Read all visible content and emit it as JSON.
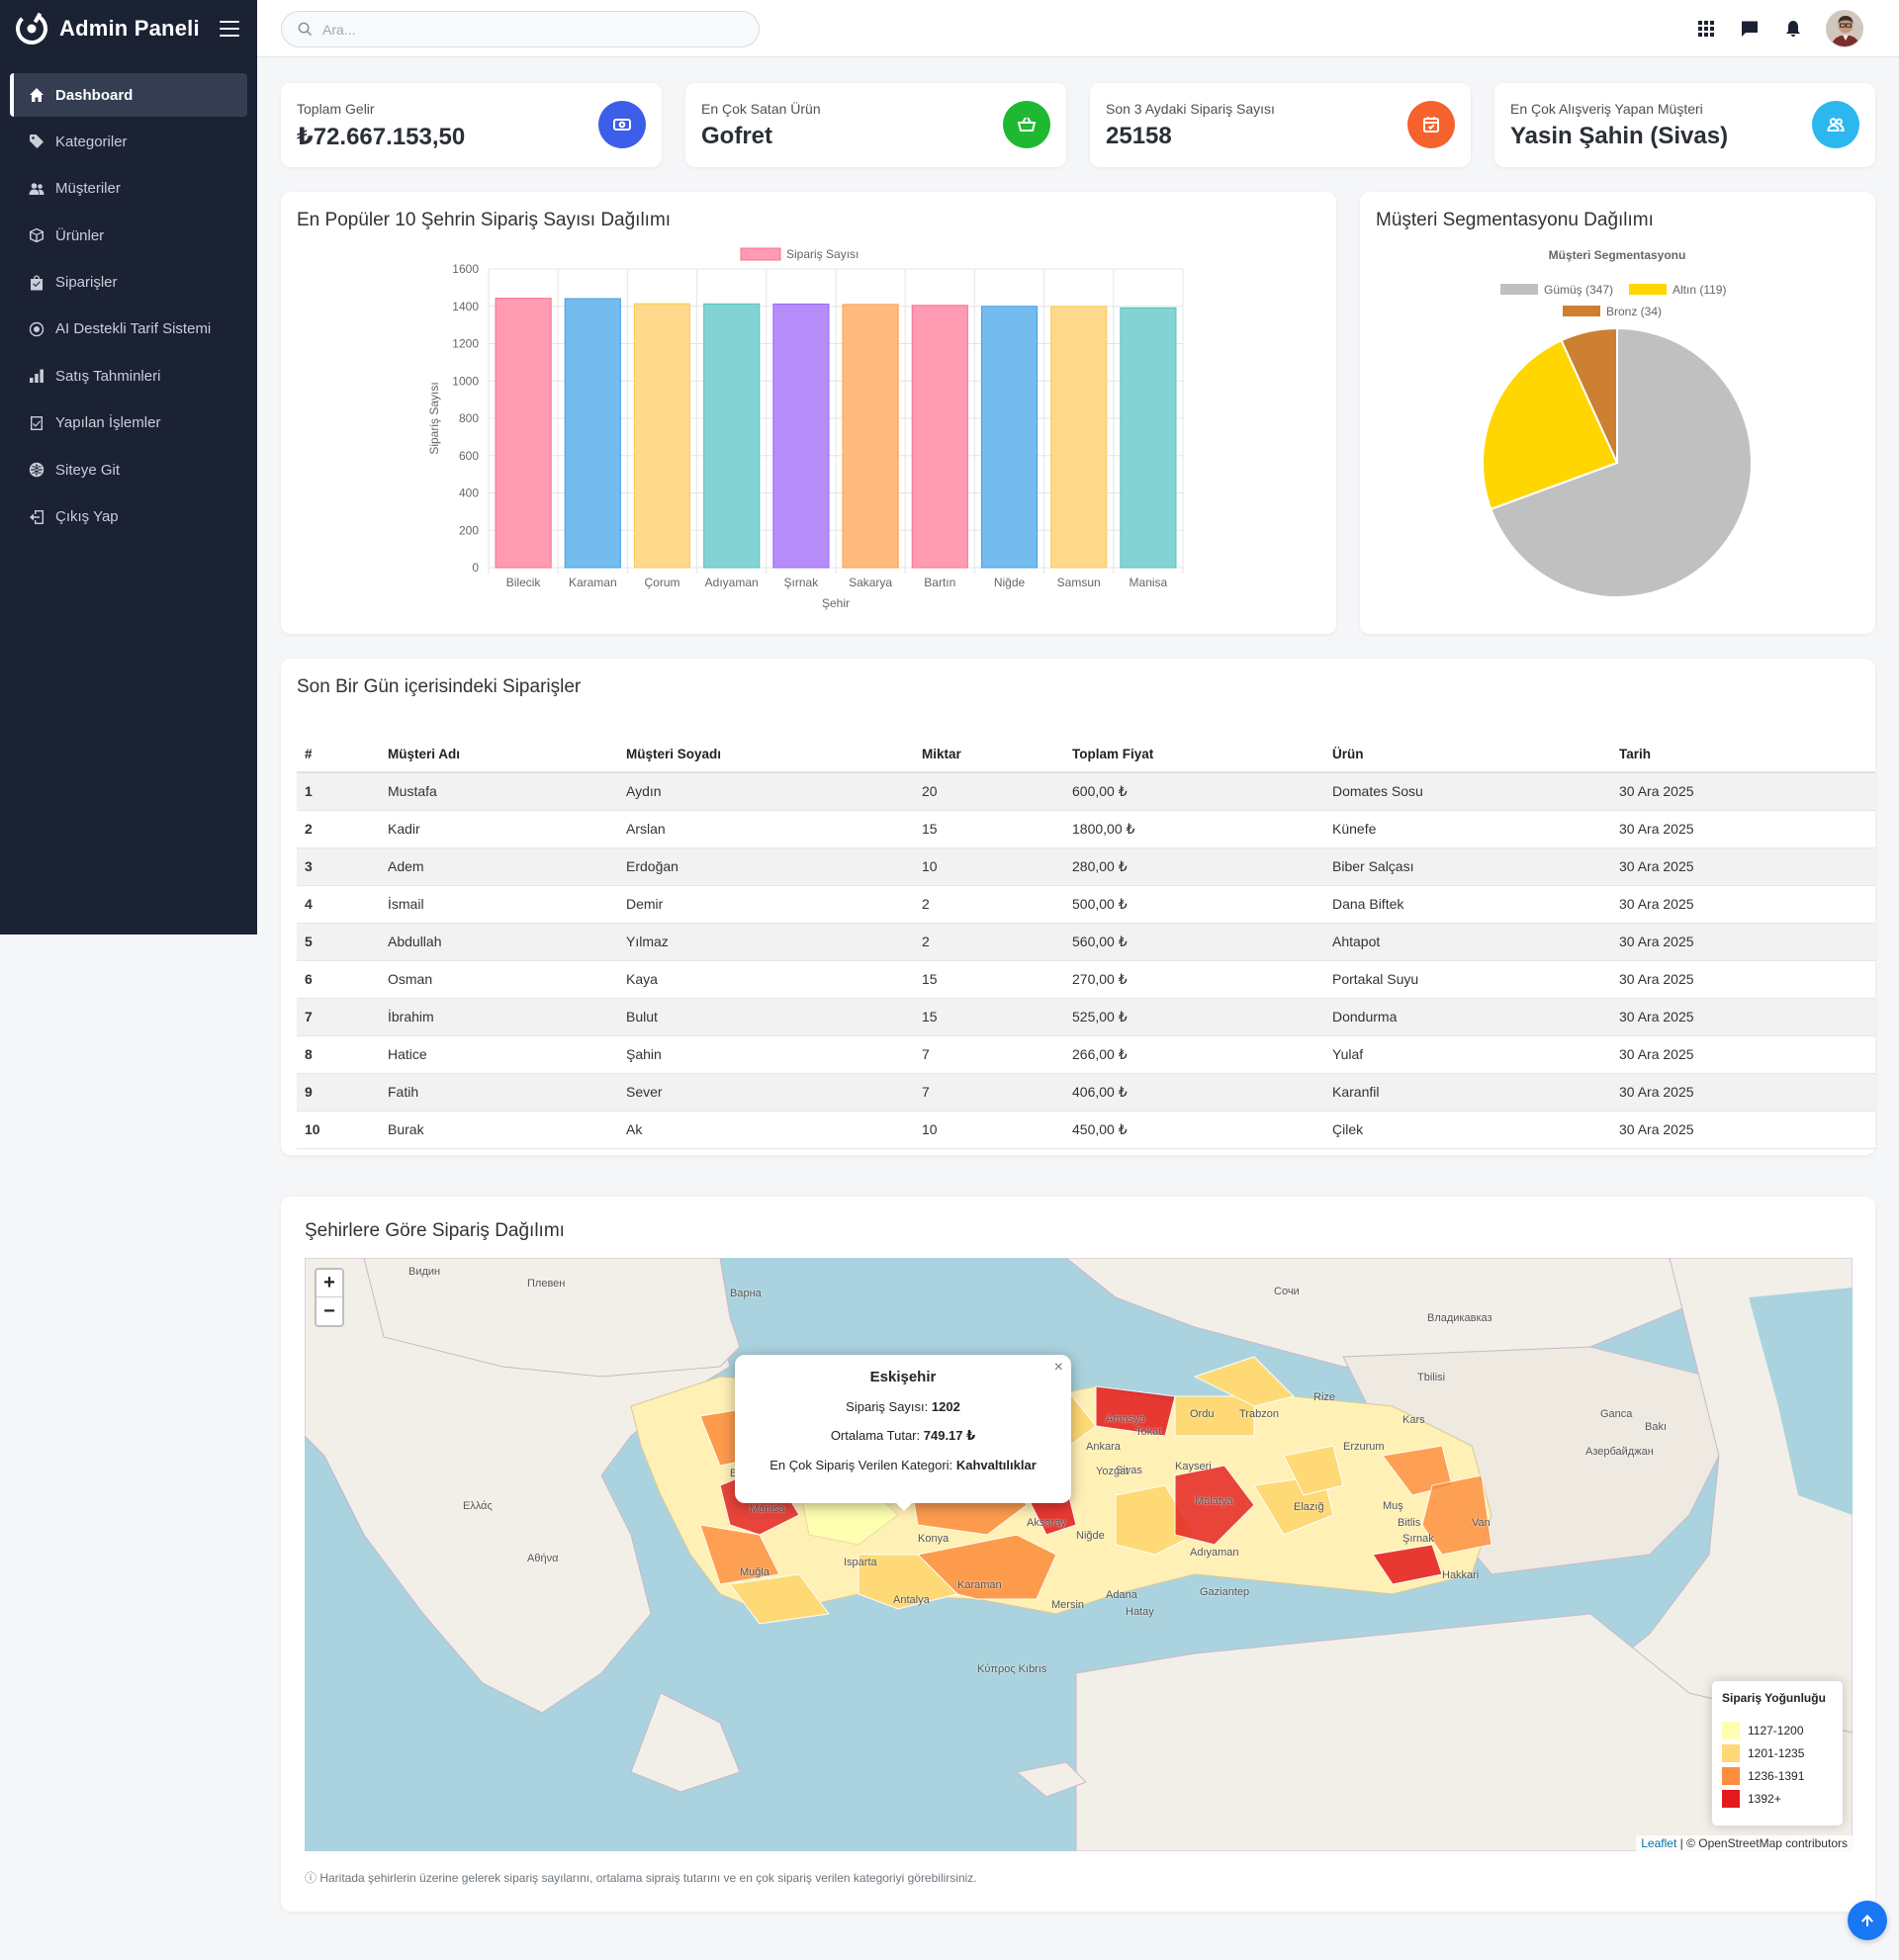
{
  "brand": {
    "name": "Admin Paneli"
  },
  "search": {
    "placeholder": "Ara..."
  },
  "sidebar": {
    "items": [
      {
        "label": "Dashboard",
        "icon": "home-icon"
      },
      {
        "label": "Kategoriler",
        "icon": "tag-icon"
      },
      {
        "label": "Müşteriler",
        "icon": "users-icon"
      },
      {
        "label": "Ürünler",
        "icon": "box-icon"
      },
      {
        "label": "Siparişler",
        "icon": "bag-icon"
      },
      {
        "label": "AI Destekli Tarif Sistemi",
        "icon": "ai-icon"
      },
      {
        "label": "Satış Tahminleri",
        "icon": "chart-icon"
      },
      {
        "label": "Yapılan İşlemler",
        "icon": "checklist-icon"
      },
      {
        "label": "Siteye Git",
        "icon": "globe-icon"
      },
      {
        "label": "Çıkış Yap",
        "icon": "logout-icon"
      }
    ]
  },
  "stats": [
    {
      "label": "Toplam Gelir",
      "value": "₺72.667.153,50",
      "color": "#3d5ee8",
      "icon": "money-icon"
    },
    {
      "label": "En Çok Satan Ürün",
      "value": "Gofret",
      "color": "#1fb832",
      "icon": "basket-icon"
    },
    {
      "label": "Son 3 Aydaki Sipariş Sayısı",
      "value": "25158",
      "color": "#f5622d",
      "icon": "calendar-icon"
    },
    {
      "label": "En Çok Alışveriş Yapan Müşteri",
      "value": "Yasin Şahin (Sivas)",
      "color": "#2cb8ee",
      "icon": "people-icon"
    }
  ],
  "bar_card": {
    "title": "En Popüler 10 Şehrin Sipariş Sayısı Dağılımı"
  },
  "pie_card": {
    "title": "Müşteri Segmentasyonu Dağılımı"
  },
  "chart_data": [
    {
      "type": "bar",
      "title": "",
      "legend": "Sipariş Sayısı",
      "xlabel": "Şehir",
      "ylabel": "Sipariş Sayısı",
      "ylim": [
        0,
        1600
      ],
      "yticks": [
        0,
        200,
        400,
        600,
        800,
        1000,
        1200,
        1400,
        1600
      ],
      "categories": [
        "Bilecik",
        "Karaman",
        "Çorum",
        "Adıyaman",
        "Şırnak",
        "Sakarya",
        "Bartın",
        "Niğde",
        "Samsun",
        "Manisa"
      ],
      "values": [
        1443,
        1441,
        1414,
        1413,
        1412,
        1410,
        1405,
        1400,
        1400,
        1392
      ],
      "fills": [
        "#ff9bb2",
        "#74bbee",
        "#fed98b",
        "#84d3d3",
        "#b68cf9",
        "#ffba7f",
        "#ff9bb2",
        "#74bbee",
        "#fed98b",
        "#84d3d3"
      ],
      "strokes": [
        "#ff6c8d",
        "#3fa0e6",
        "#fdc956",
        "#56c1c1",
        "#9966ff",
        "#ff9f40",
        "#ff6c8d",
        "#3fa0e6",
        "#fdc956",
        "#56c1c1"
      ]
    },
    {
      "type": "pie",
      "title": "Müşteri Segmentasyonu",
      "legend_position": "top",
      "series": [
        {
          "name": "Gümüş (347)",
          "value": 347,
          "color": "#c0c0c0"
        },
        {
          "name": "Altın (119)",
          "value": 119,
          "color": "#ffd600"
        },
        {
          "name": "Bronz (34)",
          "value": 34,
          "color": "#cd7f32"
        }
      ]
    }
  ],
  "orders": {
    "title": "Son Bir Gün içerisindeki Siparişler",
    "columns": [
      "#",
      "Müşteri Adı",
      "Müşteri Soyadı",
      "Miktar",
      "Toplam Fiyat",
      "Ürün",
      "Tarih"
    ],
    "rows": [
      [
        "1",
        "Mustafa",
        "Aydın",
        "20",
        "600,00 ₺",
        "Domates Sosu",
        "30 Ara 2025"
      ],
      [
        "2",
        "Kadir",
        "Arslan",
        "15",
        "1800,00 ₺",
        "Künefe",
        "30 Ara 2025"
      ],
      [
        "3",
        "Adem",
        "Erdoğan",
        "10",
        "280,00 ₺",
        "Biber Salçası",
        "30 Ara 2025"
      ],
      [
        "4",
        "İsmail",
        "Demir",
        "2",
        "500,00 ₺",
        "Dana Biftek",
        "30 Ara 2025"
      ],
      [
        "5",
        "Abdullah",
        "Yılmaz",
        "2",
        "560,00 ₺",
        "Ahtapot",
        "30 Ara 2025"
      ],
      [
        "6",
        "Osman",
        "Kaya",
        "15",
        "270,00 ₺",
        "Portakal Suyu",
        "30 Ara 2025"
      ],
      [
        "7",
        "İbrahim",
        "Bulut",
        "15",
        "525,00 ₺",
        "Dondurma",
        "30 Ara 2025"
      ],
      [
        "8",
        "Hatice",
        "Şahin",
        "7",
        "266,00 ₺",
        "Yulaf",
        "30 Ara 2025"
      ],
      [
        "9",
        "Fatih",
        "Sever",
        "7",
        "406,00 ₺",
        "Karanfil",
        "30 Ara 2025"
      ],
      [
        "10",
        "Burak",
        "Ak",
        "10",
        "450,00 ₺",
        "Çilek",
        "30 Ara 2025"
      ]
    ]
  },
  "map_card": {
    "title": "Şehirlere Göre Sipariş Dağılımı",
    "note": "ⓘ Haritada şehirlerin üzerine gelerek sipariş sayılarını, ortalama sipraiş tutarını ve en çok sipariş verilen kategoriyi görebilirsiniz.",
    "zoom_in": "+",
    "zoom_out": "−",
    "popup": {
      "city": "Eskişehir",
      "orders_label": "Sipariş Sayısı:",
      "orders_value": "1202",
      "avg_label": "Ortalama Tutar:",
      "avg_value": "749.17 ₺",
      "category_label": "En Çok Sipariş Verilen Kategori:",
      "category_value": "Kahvaltılıklar",
      "close": "×"
    },
    "legend": {
      "title": "Sipariş Yoğunluğu",
      "items": [
        {
          "label": "1127-1200",
          "color": "#ffffb2"
        },
        {
          "label": "1201-1235",
          "color": "#fed976"
        },
        {
          "label": "1236-1391",
          "color": "#fd8d3c"
        },
        {
          "label": "1392+",
          "color": "#e31a1c"
        }
      ]
    },
    "attribution_link": "Leaflet",
    "attribution_text": " | © OpenStreetMap contributors",
    "labels": [
      "Видин",
      "Плевен",
      "Варна",
      "Сочи",
      "Владикавказ",
      "Азербайджан",
      "Ankara",
      "Eskişehir",
      "Balıkesir",
      "Manisa",
      "Konya",
      "Antalya",
      "Isparta",
      "Muğla",
      "Niğde",
      "Karaman",
      "Adıyaman",
      "Malatya",
      "Elazığ",
      "Sivas",
      "Tokat",
      "Amasya",
      "Ordu",
      "Trabzon",
      "Kars",
      "Erzurum",
      "Van",
      "Bitlis",
      "Muş",
      "Şırnak",
      "Hakkari",
      "Mersin",
      "Hatay",
      "Adana",
      "Gaziantep",
      "Aksaray",
      "Yozgat",
      "Kayseri",
      "Κύπρος Kıbrıs",
      "Ελλάς",
      "Αθήνα",
      "Bakı",
      "Rize",
      "Tbilisi",
      "Ganca"
    ]
  }
}
